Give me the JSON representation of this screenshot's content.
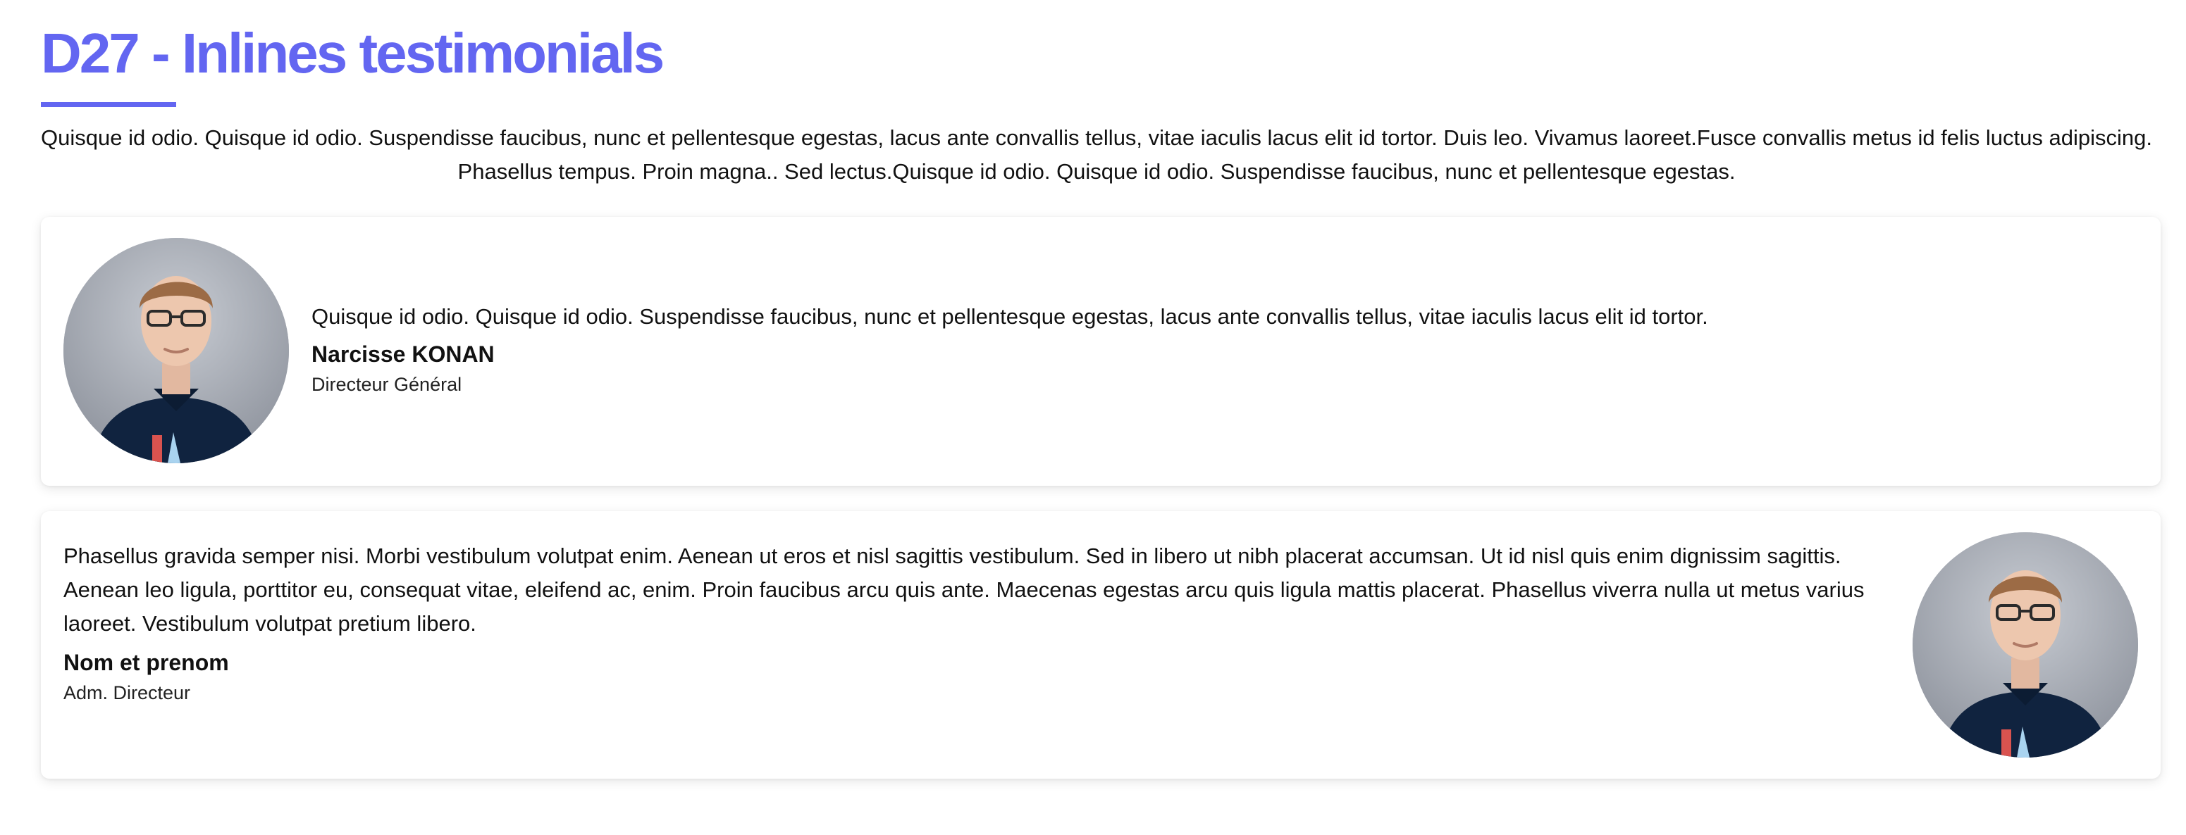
{
  "page": {
    "title": "D27 - Inlines testimonials",
    "intro": "Quisque id odio. Quisque id odio. Suspendisse faucibus, nunc et pellentesque egestas, lacus ante convallis tellus, vitae iaculis lacus elit id tortor. Duis leo. Vivamus laoreet.Fusce convallis metus id felis luctus adipiscing. Phasellus tempus. Proin magna.. Sed lectus.Quisque id odio. Quisque id odio. Suspendisse faucibus, nunc et pellentesque egestas."
  },
  "colors": {
    "accent": "#6366f1",
    "text": "#111111",
    "card_background": "#ffffff"
  },
  "testimonials": [
    {
      "quote": "Quisque id odio. Quisque id odio. Suspendisse faucibus, nunc et pellentesque egestas, lacus ante convallis tellus, vitae iaculis lacus elit id tortor.",
      "name": "Narcisse KONAN",
      "role": "Directeur Général",
      "avatar_icon": "person-portrait"
    },
    {
      "quote_lines": [
        "Phasellus gravida semper nisi. Morbi vestibulum volutpat enim. Aenean ut eros et nisl sagittis vestibulum. Sed in libero ut nibh placerat accumsan. Ut id nisl quis enim dignissim sagittis.",
        "Aenean leo ligula, porttitor eu, consequat vitae, eleifend ac, enim. Proin faucibus arcu quis ante. Maecenas egestas arcu quis ligula mattis placerat. Phasellus viverra nulla ut metus varius laoreet. Vestibulum volutpat pretium libero."
      ],
      "name": "Nom et prenom",
      "role": "Adm. Directeur",
      "avatar_icon": "person-portrait"
    }
  ]
}
